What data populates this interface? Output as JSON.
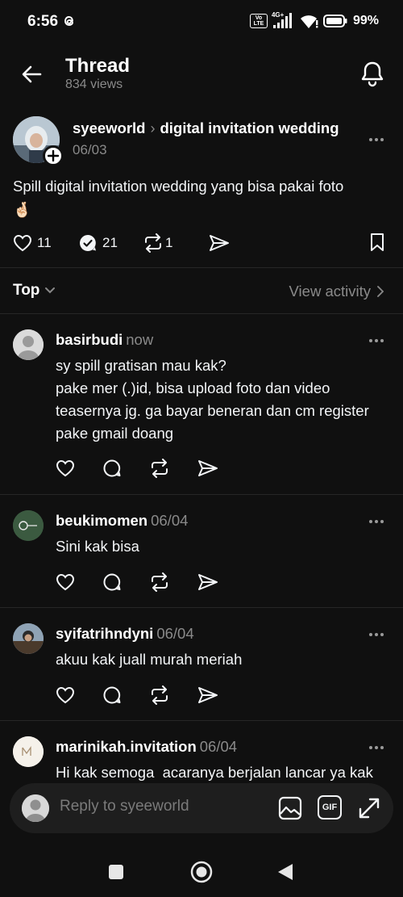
{
  "status_bar": {
    "time": "6:56",
    "network": "4G+",
    "volte": "Vo LTE",
    "battery": "99%"
  },
  "header": {
    "title": "Thread",
    "views": "834 views"
  },
  "post": {
    "author": "syeeworld",
    "topic": "digital invitation wedding",
    "date": "06/03",
    "text": "Spill digital invitation wedding yang bisa pakai foto",
    "emoji": "🤞🏻",
    "likes": "11",
    "replies": "21",
    "reposts": "1"
  },
  "sort": {
    "label": "Top",
    "view_activity": "View activity"
  },
  "replies": [
    {
      "author": "basirbudi",
      "time": "now",
      "text": "sy spill gratisan mau kak?\npake mer (.)id, bisa upload foto dan video teasernya jg. ga bayar beneran dan cm register pake gmail doang"
    },
    {
      "author": "beukimomen",
      "time": "06/04",
      "text": "Sini kak bisa"
    },
    {
      "author": "syifatrihndyni",
      "time": "06/04",
      "text": "akuu kak juall murah meriah"
    },
    {
      "author": "marinikah.invitation",
      "time": "06/04",
      "text": "Hi kak semoga  acaranya berjalan lancar ya kak"
    }
  ],
  "reply_bar": {
    "placeholder": "Reply to syeeworld",
    "gif": "GIF"
  },
  "colors": {
    "background": "#101010",
    "text": "#f3f5f7",
    "secondary": "#8a8a8a",
    "divider": "#262626",
    "input_bg": "#1e1e1e"
  }
}
